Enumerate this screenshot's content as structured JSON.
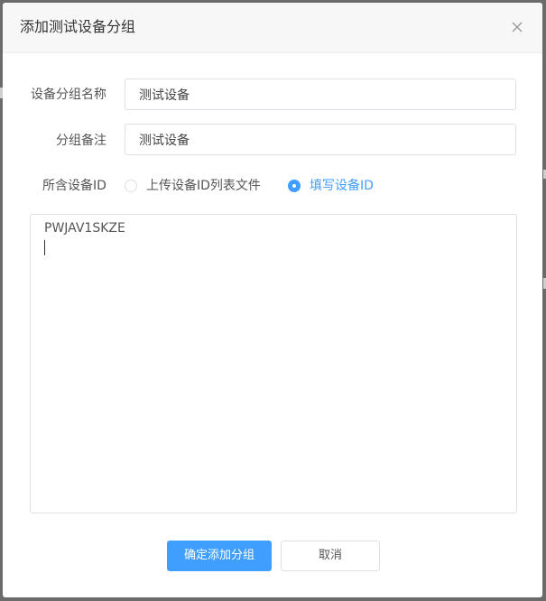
{
  "dialog": {
    "title": "添加测试设备分组",
    "close_icon": "close-icon"
  },
  "form": {
    "group_name": {
      "label": "设备分组名称",
      "value": "测试设备"
    },
    "group_note": {
      "label": "分组备注",
      "value": "测试设备"
    },
    "device_ids": {
      "label": "所含设备ID",
      "options": [
        {
          "label": "上传设备ID列表文件",
          "checked": false
        },
        {
          "label": "填写设备ID",
          "checked": true
        }
      ],
      "textarea_value": "PWJAV1SKZE\n"
    }
  },
  "buttons": {
    "confirm_label": "确定添加分组",
    "cancel_label": "取消"
  },
  "colors": {
    "accent": "#409eff",
    "border": "#dcdfe6",
    "header_bg": "#f7f7f7"
  }
}
